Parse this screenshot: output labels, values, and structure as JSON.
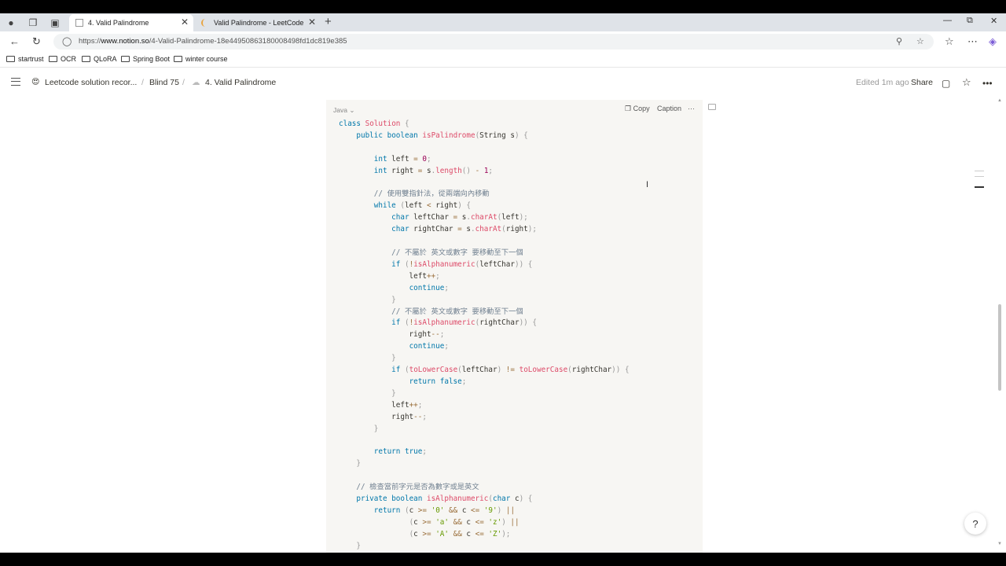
{
  "tabs": [
    {
      "label": "4. Valid Palindrome",
      "active": true
    },
    {
      "label": "Valid Palindrome - LeetCode",
      "active": false
    }
  ],
  "address": {
    "prefix": "https://",
    "domain": "www.notion.so",
    "path": "/4-Valid-Palindrome-18e44950863180008498fd1dc819e385"
  },
  "bookmarks": [
    "startrust",
    "OCR",
    "QLoRA",
    "Spring Boot",
    "winter course"
  ],
  "breadcrumb": {
    "root": "Leetcode solution recor...",
    "parent": "Blind 75",
    "current": "4. Valid Palindrome"
  },
  "header": {
    "edited": "Edited 1m ago",
    "share": "Share"
  },
  "codeblock": {
    "language": "Java",
    "copy": "Copy",
    "caption": "Caption"
  },
  "icons": {
    "back": "back-arrow-icon",
    "refresh": "refresh-icon",
    "more": "more-dots-icon",
    "favorite": "star-icon",
    "comments": "comment-icon"
  }
}
